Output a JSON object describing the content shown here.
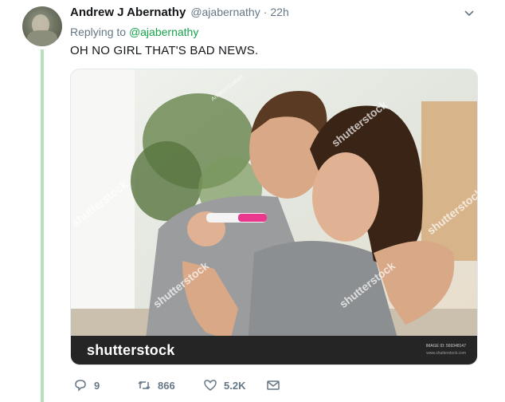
{
  "tweet": {
    "display_name": "Andrew J Abernathy",
    "handle": "@ajabernathy",
    "separator": "·",
    "time": "22h",
    "replying_prefix": "Replying to",
    "replying_to": "@ajabernathy",
    "text": "OH NO GIRL THAT'S BAD NEWS."
  },
  "media": {
    "watermark": "shutterstock",
    "photographer": "Antonio Guillem",
    "footer_logo": "shutterstock",
    "image_id_label": "IMAGE ID: 569348147",
    "site": "www.shutterstock.com"
  },
  "actions": {
    "reply_count": "9",
    "retweet_count": "866",
    "like_count": "5.2K"
  },
  "colors": {
    "thread_line": "#b8e1c0",
    "mention": "#17a34a",
    "meta_text": "#657786"
  }
}
